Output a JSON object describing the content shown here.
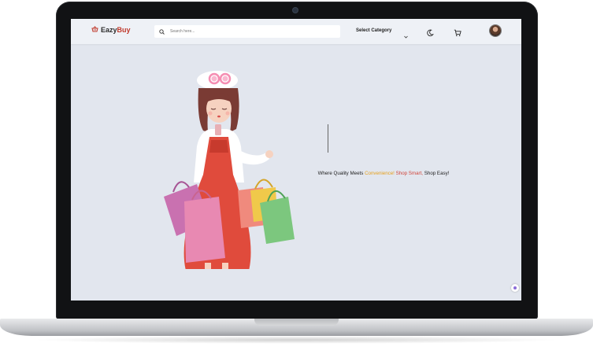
{
  "brand": {
    "part1": "Eazy",
    "part2": "Buy",
    "icon": "basket-icon"
  },
  "search": {
    "placeholder": "Search here..."
  },
  "category": {
    "label": "Select Category"
  },
  "icons": {
    "theme": "moon-icon",
    "cart": "cart-icon",
    "profile": "avatar",
    "chat": "chat-bubble-icon"
  },
  "hero": {
    "tagline_start": "Where Quality Meets ",
    "tagline_convenience": "Convenience!",
    "tagline_space": " ",
    "tagline_shop_smart": "Shop Smart,",
    "tagline_end": " Shop Easy!"
  },
  "colors": {
    "accent_red": "#c0392b",
    "accent_yellow": "#e6a01c",
    "background": "#e2e6ee"
  }
}
